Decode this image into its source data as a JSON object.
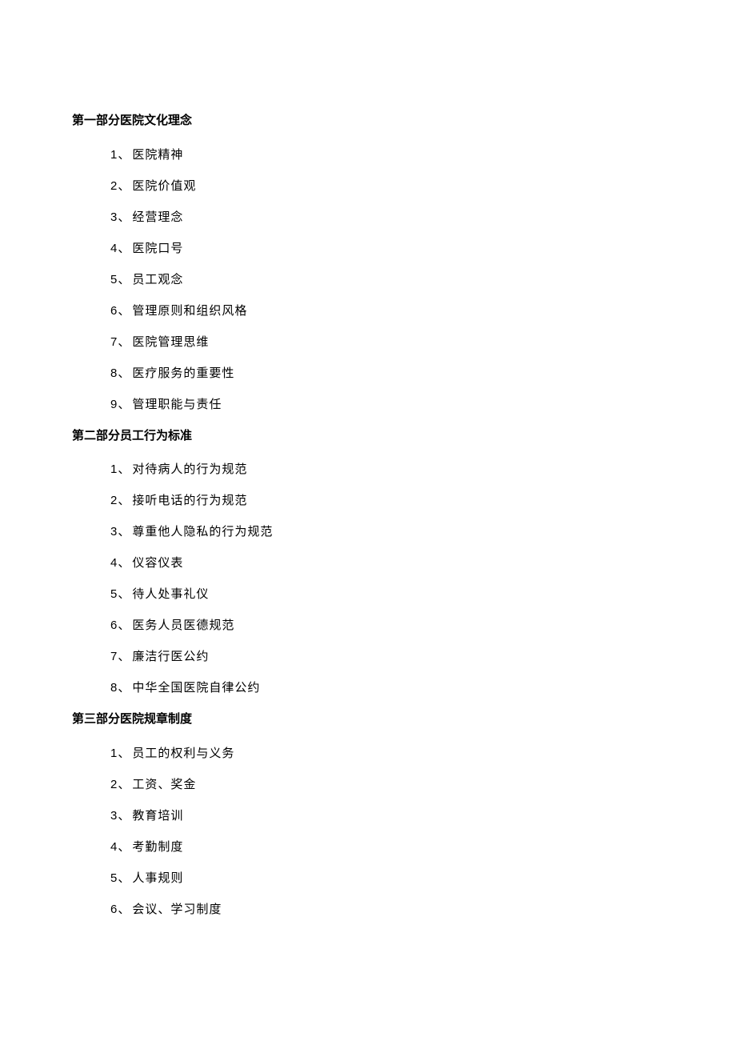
{
  "sections": [
    {
      "title": "第一部分医院文化理念",
      "items": [
        {
          "num": "1",
          "sep": "、",
          "text": "医院精神"
        },
        {
          "num": "2",
          "sep": "、",
          "text": "医院价值观"
        },
        {
          "num": "3",
          "sep": "、",
          "text": "经营理念"
        },
        {
          "num": "4",
          "sep": "、",
          "text": "医院口号"
        },
        {
          "num": "5",
          "sep": "、",
          "text": "员工观念"
        },
        {
          "num": "6",
          "sep": "、",
          "text": "管理原则和组织风格"
        },
        {
          "num": "7",
          "sep": "、",
          "text": "医院管理思维"
        },
        {
          "num": "8",
          "sep": "、",
          "text": "医疗服务的重要性"
        },
        {
          "num": "9",
          "sep": "、",
          "text": "管理职能与责任"
        }
      ]
    },
    {
      "title": "第二部分员工行为标准",
      "items": [
        {
          "num": "1",
          "sep": "、",
          "text": "对待病人的行为规范"
        },
        {
          "num": "2",
          "sep": "、",
          "text": "接听电话的行为规范"
        },
        {
          "num": "3",
          "sep": "、",
          "text": "尊重他人隐私的行为规范"
        },
        {
          "num": "4",
          "sep": "、",
          "text": "仪容仪表"
        },
        {
          "num": "5",
          "sep": "、",
          "text": "待人处事礼仪"
        },
        {
          "num": "6",
          "sep": "、",
          "text": "医务人员医德规范"
        },
        {
          "num": "7",
          "sep": "、",
          "text": "廉洁行医公约"
        },
        {
          "num": "8",
          "sep": "、",
          "text": "中华全国医院自律公约"
        }
      ]
    },
    {
      "title": "第三部分医院规章制度",
      "items": [
        {
          "num": "1",
          "sep": "、",
          "text": "员工的权利与义务"
        },
        {
          "num": "2",
          "sep": "、",
          "text": "工资、奖金"
        },
        {
          "num": "3",
          "sep": "、",
          "text": "教育培训"
        },
        {
          "num": "4",
          "sep": "、",
          "text": "考勤制度"
        },
        {
          "num": "5",
          "sep": "、",
          "text": "人事规则"
        },
        {
          "num": "6",
          "sep": "、",
          "text": "会议、学习制度"
        }
      ]
    }
  ]
}
